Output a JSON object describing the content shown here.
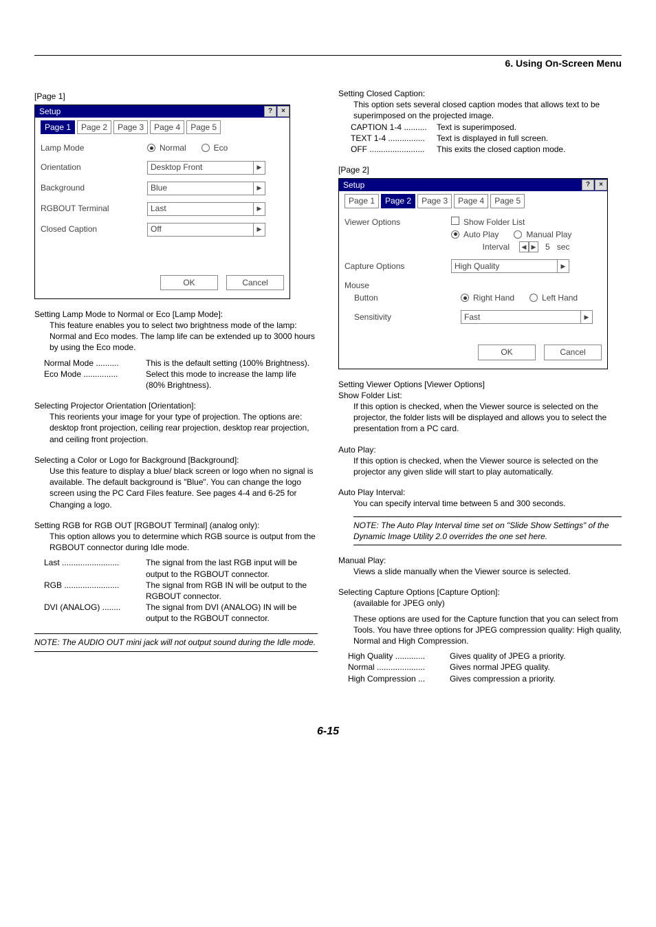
{
  "header": {
    "title": "6. Using On-Screen Menu"
  },
  "page_number": "6-15",
  "dlg_common": {
    "tabs": [
      "Page 1",
      "Page 2",
      "Page 3",
      "Page 4",
      "Page 5"
    ],
    "title": "Setup",
    "help": "?",
    "close": "×",
    "ok": "OK",
    "cancel": "Cancel",
    "arrow": "▶"
  },
  "left": {
    "page_tag": "[Page 1]",
    "dlg": {
      "lamp_mode_label": "Lamp Mode",
      "lamp_normal": "Normal",
      "lamp_eco": "Eco",
      "orientation_label": "Orientation",
      "orientation_value": "Desktop Front",
      "background_label": "Background",
      "background_value": "Blue",
      "rgbout_label": "RGBOUT Terminal",
      "rgbout_value": "Last",
      "cc_label": "Closed Caption",
      "cc_value": "Off"
    },
    "lamp_title": "Setting Lamp Mode to Normal or Eco [Lamp Mode]:",
    "lamp_desc": "This feature enables you to select two brightness mode of the lamp: Normal and Eco modes. The lamp life can be extended up to 3000 hours by using the Eco mode.",
    "lamp_rows": [
      {
        "t": "Normal Mode ..........",
        "d": "This is the default setting (100% Brightness)."
      },
      {
        "t": "Eco Mode ...............",
        "d": "Select this mode to increase the lamp life (80% Brightness)."
      }
    ],
    "orient_title": "Selecting Projector Orientation [Orientation]:",
    "orient_desc": "This reorients your image for your type of projection. The options are: desktop front projection, ceiling rear projection, desktop rear projection, and ceiling front projection.",
    "bg_title": "Selecting a Color or Logo for Background [Background]:",
    "bg_desc": "Use this feature to display a blue/ black screen or logo when no signal is available. The default background is \"Blue\". You can change the logo screen using the PC Card Files feature. See pages 4-4 and 6-25 for Changing a logo.",
    "rgb_title": "Setting RGB for RGB OUT [RGBOUT Terminal] (analog only):",
    "rgb_desc": "This option allows you to determine which RGB source is output from the RGBOUT connector during Idle mode.",
    "rgb_rows": [
      {
        "t": "Last .........................",
        "d": "The signal from the last RGB input will be output to the RGBOUT connector."
      },
      {
        "t": "RGB ........................",
        "d": "The signal from RGB IN will be output to the RGBOUT connector."
      },
      {
        "t": "DVI (ANALOG) ........",
        "d": "The signal from DVI (ANALOG) IN will be output to the RGBOUT connector."
      }
    ],
    "note": "NOTE: The AUDIO OUT mini jack will not output sound during the Idle mode."
  },
  "right": {
    "cc_title": "Setting Closed Caption:",
    "cc_desc": "This option sets several closed caption modes that allows text to be superimposed on the projected image.",
    "cc_rows": [
      {
        "t": "CAPTION 1-4 ..........",
        "d": "Text is superimposed."
      },
      {
        "t": "TEXT 1-4 ................",
        "d": "Text is displayed in full screen."
      },
      {
        "t": "OFF ........................",
        "d": "This exits the closed caption mode."
      }
    ],
    "page_tag": "[Page 2]",
    "dlg": {
      "viewer_label": "Viewer Options",
      "show_folder": "Show Folder List",
      "auto_play": "Auto Play",
      "manual_play": "Manual Play",
      "interval_label": "Interval",
      "interval_value": "5",
      "interval_unit": "sec",
      "capture_label": "Capture Options",
      "capture_value": "High Quality",
      "mouse_label": "Mouse",
      "button_label": "Button",
      "right_hand": "Right Hand",
      "left_hand": "Left Hand",
      "sensitivity_label": "Sensitivity",
      "sensitivity_value": "Fast"
    },
    "viewer_title": "Setting Viewer Options [Viewer Options]",
    "folder_title": "Show Folder List:",
    "folder_desc": "If this option is checked, when the Viewer source is selected on the projector, the folder lists will be displayed and allows you to select the presentation from a PC card.",
    "auto_title": "Auto Play:",
    "auto_desc": "If this option is checked, when the Viewer source is selected on the projector any given slide will start to play automatically.",
    "interval_title": "Auto Play Interval:",
    "interval_desc": "You can specify interval time between 5 and 300 seconds.",
    "note": "NOTE: The Auto Play Interval time set on \"Slide Show Settings\" of the Dynamic Image Utility 2.0 overrides the one set here.",
    "manual_title": "Manual Play:",
    "manual_desc": "Views a slide manually when the Viewer source is selected.",
    "cap_title": "Selecting Capture Options [Capture Option]:",
    "cap_sub": "(available for JPEG only)",
    "cap_desc": "These options are used for the Capture function that you can select from Tools. You have three options for JPEG compression quality: High quality, Normal and High Compression.",
    "cap_rows": [
      {
        "t": "High Quality .............",
        "d": "Gives quality of JPEG a priority."
      },
      {
        "t": "Normal .....................",
        "d": "Gives normal JPEG quality."
      },
      {
        "t": "High Compression ...",
        "d": "Gives compression a priority."
      }
    ]
  }
}
